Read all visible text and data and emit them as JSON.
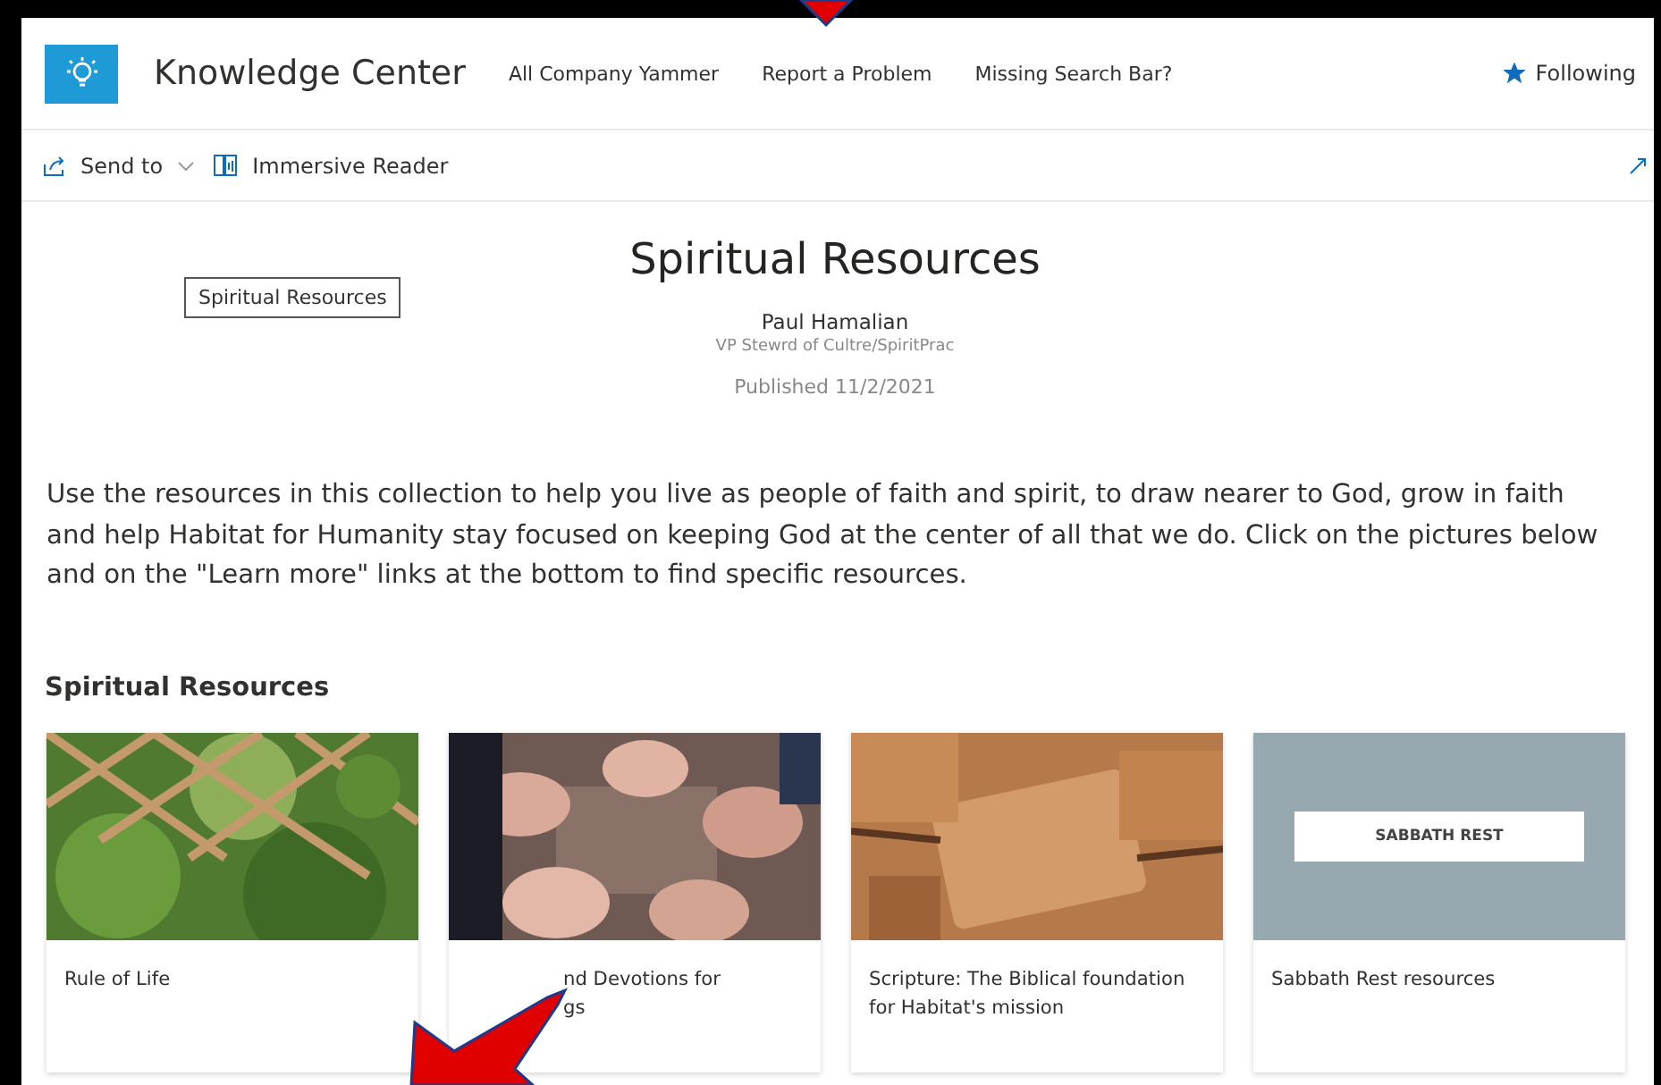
{
  "site": {
    "title": "Knowledge Center",
    "nav": [
      "All Company Yammer",
      "Report a Problem",
      "Missing Search Bar?"
    ],
    "follow": {
      "label": "Following",
      "on": true
    }
  },
  "command_bar": {
    "items": [
      "Send to",
      "Immersive Reader"
    ]
  },
  "page": {
    "tag": "Spiritual Resources",
    "title": "Spiritual Resources",
    "author": "Paul Hamalian",
    "author_role": "VP Stewrd of Cultre/SpiritPrac",
    "published": "Published 11/2/2021",
    "intro": "Use the resources in this collection to help you live as people of faith and spirit, to draw nearer to God, grow in faith and help Habitat for Humanity stay focused on keeping God at the center of all that we do. Click on the pictures below and on the \"Learn more\" links at the bottom to find specific resources."
  },
  "section": {
    "title": "Spiritual Resources",
    "cards": [
      {
        "kind": "picture",
        "lines": [
          "Rule of Life"
        ]
      },
      {
        "kind": "picture",
        "lines": [
          "nd Devotions for",
          "gs"
        ]
      },
      {
        "kind": "picture",
        "lines": [
          "Scripture: The Biblical foundation",
          "for Habitat's mission"
        ]
      },
      {
        "kind": "banner",
        "banner": "SABBATH REST",
        "lines": [
          "Sabbath Rest resources"
        ]
      }
    ]
  }
}
